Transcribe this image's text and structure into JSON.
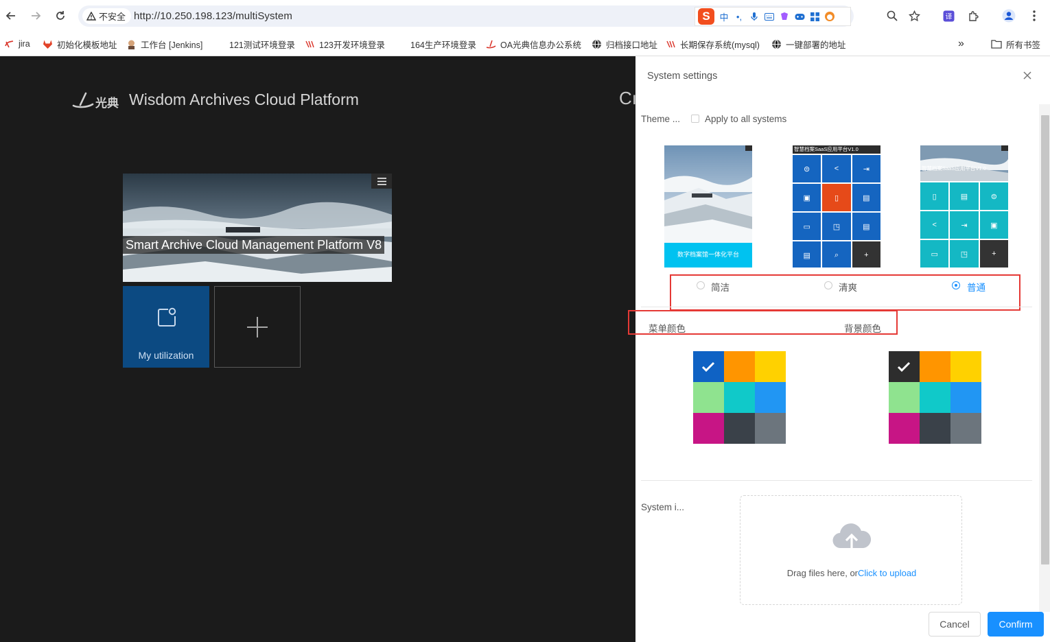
{
  "browser": {
    "security_label": "不安全",
    "url": "http://10.250.198.123/multiSystem",
    "ime_label": "中",
    "ime_punct": "•,",
    "bookmarks": [
      {
        "label": "jira",
        "icon": "jira-icon",
        "color": "#d93025"
      },
      {
        "label": "初始化模板地址",
        "icon": "gitlab-icon",
        "color": "#e24329"
      },
      {
        "label": "工作台 [Jenkins]",
        "icon": "jenkins-icon",
        "color": "#b06a3b"
      },
      {
        "label": "121测试环境登录",
        "icon": "",
        "color": ""
      },
      {
        "label": "123开发环境登录",
        "icon": "site-icon",
        "color": "#d93025"
      },
      {
        "label": "164生产环境登录",
        "icon": "",
        "color": ""
      },
      {
        "label": "OA光典信息办公系统",
        "icon": "oa-icon",
        "color": "#d93025"
      },
      {
        "label": "归档接口地址",
        "icon": "globe-icon",
        "color": "#555555"
      },
      {
        "label": "长期保存系统(mysql)",
        "icon": "site-icon",
        "color": "#d93025"
      },
      {
        "label": "一键部署的地址",
        "icon": "globe-icon",
        "color": "#555555"
      }
    ],
    "more_label": "»",
    "all_bookmarks_label": "所有书签"
  },
  "page": {
    "brand_title": "Wisdom Archives Cloud Platform",
    "brand_logo_text": "光典",
    "cut_title": "Cı",
    "banner_title": "Smart Archive Cloud Management Platform V8",
    "tile_util_label": "My utilization"
  },
  "drawer": {
    "title": "System settings",
    "theme_label": "Theme ...",
    "apply_all_label": "Apply to all systems",
    "apply_all_checked": false,
    "themes": [
      {
        "name": "简洁",
        "caption": "数字档案馆一体化平台",
        "selected": false
      },
      {
        "name": "清爽",
        "caption": "智慧档案SaaS应用平台V1.0",
        "selected": false
      },
      {
        "name": "普通",
        "caption": "智慧档案SaaS应用平台V1.0",
        "selected": true
      }
    ],
    "menu_color_label": "菜单颜色",
    "bg_color_label": "背景颜色",
    "palette": [
      "#0f62c4",
      "#ff9500",
      "#ffd100",
      "#8fe38f",
      "#10c9c9",
      "#2196f3",
      "#c71585",
      "#3a4149",
      "#6c757d"
    ],
    "bg_palette": [
      "#2d2d2d",
      "#ff9500",
      "#ffd100",
      "#8fe38f",
      "#10c9c9",
      "#2196f3",
      "#c71585",
      "#3a4149",
      "#6c757d"
    ],
    "menu_color_selected": 0,
    "bg_color_selected": 0,
    "system_icon_label": "System i...",
    "upload_text": "Drag files here, or",
    "upload_link": "Click to upload",
    "cancel_label": "Cancel",
    "confirm_label": "Confirm"
  }
}
